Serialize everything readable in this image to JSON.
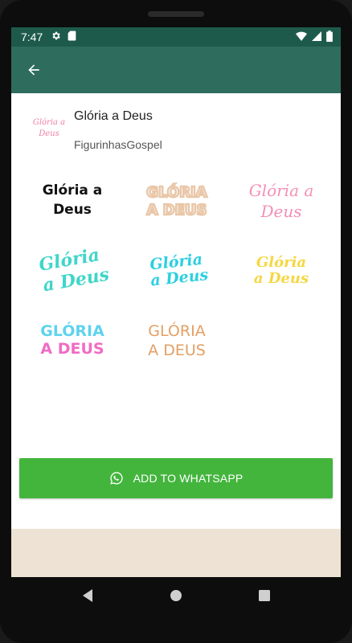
{
  "status_bar": {
    "time": "7:47"
  },
  "pack": {
    "title": "Glória a Deus",
    "publisher": "FigurinhasGospel"
  },
  "stickers": [
    {
      "line1": "Glória a",
      "line2": "Deus"
    },
    {
      "line1": "GLÓRIA",
      "line2": "A DEUS"
    },
    {
      "line1": "Glória a",
      "line2": "Deus"
    },
    {
      "line1": "Glória",
      "line2": "a Deus"
    },
    {
      "line1": "Glória",
      "line2": "a Deus"
    },
    {
      "line1": "Glória",
      "line2": "a Deus"
    },
    {
      "line1": "GLÓRIA",
      "line2": "A DEUS"
    },
    {
      "line1": "GLÓRIA",
      "line2": "A DEUS"
    }
  ],
  "pack_icon": {
    "line1": "Glória a",
    "line2": "Deus"
  },
  "add_button": {
    "label": "ADD TO WHATSAPP"
  },
  "colors": {
    "status_bar": "#1e5a4c",
    "app_bar": "#2e6c5e",
    "accent_button": "#43b53d",
    "bottom_strip": "#ede2d3"
  }
}
